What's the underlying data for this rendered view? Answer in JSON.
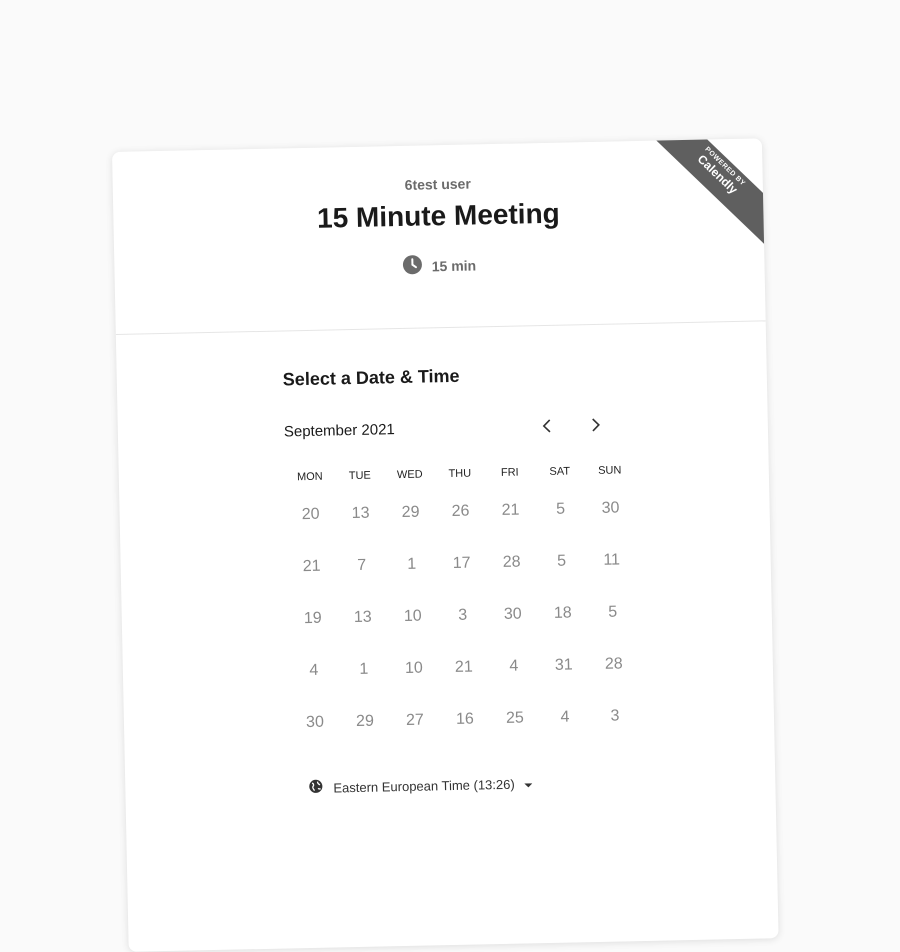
{
  "badge": {
    "small": "POWERED BY",
    "brand": "Calendly"
  },
  "header": {
    "host": "6test user",
    "title": "15 Minute Meeting",
    "duration": "15 min"
  },
  "picker": {
    "title": "Select a Date & Time",
    "month": "September 2021",
    "weekdays": [
      "MON",
      "TUE",
      "WED",
      "THU",
      "FRI",
      "SAT",
      "SUN"
    ],
    "days": [
      [
        "20",
        "13",
        "29",
        "26",
        "21",
        "5",
        "30"
      ],
      [
        "21",
        "7",
        "1",
        "17",
        "28",
        "5",
        "11"
      ],
      [
        "19",
        "13",
        "10",
        "3",
        "30",
        "18",
        "5"
      ],
      [
        "4",
        "1",
        "10",
        "21",
        "4",
        "31",
        "28"
      ],
      [
        "30",
        "29",
        "27",
        "16",
        "25",
        "4",
        "3"
      ]
    ],
    "timezone": "Eastern European Time (13:26)"
  },
  "icons": {
    "clock": "clock-icon",
    "prev": "chevron-left-icon",
    "next": "chevron-right-icon",
    "globe": "globe-icon",
    "caret": "caret-down-icon"
  },
  "colors": {
    "badge_bg": "#5f5f5f",
    "title": "#1a1a1a",
    "muted": "#6b6b6b",
    "day": "#8a8a8a"
  }
}
